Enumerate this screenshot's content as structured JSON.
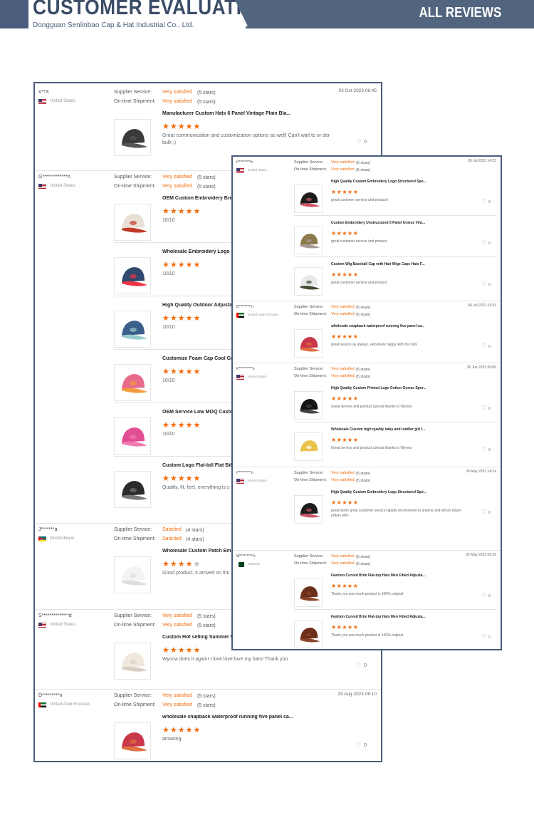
{
  "header": {
    "title": "CUSTOMER EVALUATION",
    "subtitle": "Dongguan Senlinbao Cap & Hat Industrial Co., Ltd.",
    "right": "ALL REVIEWS"
  },
  "labels": {
    "supplier": "Supplier Service:",
    "shipment": "On-time Shipment:"
  },
  "left_reviews": [
    {
      "name": "V**X",
      "country": "United States",
      "flag": "us",
      "supplier": "Very satisfied",
      "supplier_stars": "(5 stars)",
      "shipment": "Very satisfied",
      "shipment_stars": "(5 stars)",
      "date": "03 Oct 2023 06:45",
      "items": [
        {
          "title": "Manufacturer Custom Hats 6 Panel Vintage Plain Bla...",
          "rating": "★★★★★",
          "text": "Great communication and customization options as well! Can't wait to or der bulk :)",
          "likes": "0",
          "img": "dark"
        }
      ]
    },
    {
      "name": "G*************n",
      "country": "United States",
      "flag": "us",
      "supplier": "Very satisfied",
      "supplier_stars": "(5 stars)",
      "shipment": "Very satisfied",
      "shipment_stars": "(5 stars)",
      "date": "",
      "items": [
        {
          "title": "OEM Custom Embroidery Brea",
          "rating": "★★★★★",
          "text": "10/10",
          "likes": "",
          "img": "trucker"
        },
        {
          "title": "Wholesale Embroidery Logo C",
          "rating": "★★★★★",
          "text": "10/10",
          "likes": "",
          "img": "navy"
        },
        {
          "title": "High Quality Outdoor Adjustal",
          "rating": "★★★★★",
          "text": "10/10",
          "likes": "",
          "img": "multi"
        },
        {
          "title": "Customize Foam Cap Cool Gr",
          "rating": "★★★★★",
          "text": "10/10",
          "likes": "",
          "img": "pinkmix"
        },
        {
          "title": "OEM Service Low MOQ Custo",
          "rating": "★★★★★",
          "text": "10/10",
          "likes": "",
          "img": "pink"
        },
        {
          "title": "Custom Logo Flat-bill Flat Bill",
          "rating": "★★★★★",
          "text": "Quality, fit, feel, everything is s n 7 panel hat. Very impressed!",
          "likes": "",
          "img": "mesh"
        }
      ]
    },
    {
      "name": "J*******a",
      "country": "Mozambique",
      "flag": "mz",
      "supplier": "Satisfied",
      "supplier_stars": "(4 stars)",
      "shipment": "",
      "shipment_stars": "",
      "date": "",
      "items": [
        {
          "title": "Wholesale Custom Patch Emb",
          "rating": "★★★★",
          "rating_off": "★",
          "text": "Good product, it arrived on tim 1 minor request missed",
          "likes": "",
          "img": "white"
        }
      ]
    },
    {
      "name": "S**************d",
      "country": "United States",
      "flag": "us",
      "supplier": "Very satisfied",
      "supplier_stars": "(5 stars)",
      "shipment": "Very satisfied",
      "shipment_stars": "(5 stars)",
      "date": "",
      "items": [
        {
          "title": "Custom Hot selling Summer W",
          "rating": "★★★★★",
          "text": "Wyona does it again! I love love love my hats! Thank you",
          "likes": "0",
          "img": "bucket"
        }
      ]
    },
    {
      "name": "D*********n",
      "country": "United Arab Emirates",
      "flag": "uae",
      "supplier": "Very satisfied",
      "supplier_stars": "(5 stars)",
      "shipment": "Very satisfied",
      "shipment_stars": "(5 stars)",
      "date": "29 Aug 2023 06:10",
      "items": [
        {
          "title": "wholesale snapback waterproof running five panel ca...",
          "rating": "★★★★★",
          "text": "amazing",
          "likes": "0",
          "img": "red"
        }
      ]
    }
  ],
  "right_reviews": [
    {
      "name": "t**********n",
      "country": "United States",
      "flag": "us",
      "supplier": "Very satisfied",
      "supplier_stars": "(5 stars)",
      "shipment": "Very satisfied",
      "shipment_stars": "(5 stars)",
      "date": "26 Jul 2023 14:23",
      "items": [
        {
          "title": "High Quality Custom Embroidery Logo Structured Spo...",
          "rating": "★★★★★",
          "text": "great customer service and product!",
          "likes": "0",
          "img": "black"
        },
        {
          "title": "Custom Embroidery Unstructured 5 Panel Unisex Vint...",
          "rating": "★★★★★",
          "text": "great customer service and product",
          "likes": "0",
          "img": "olive"
        },
        {
          "title": "Custom Wig Baseball Cap with Hair Wigs Caps Hats F...",
          "rating": "★★★★★",
          "text": "great customer service and product",
          "likes": "0",
          "img": "wig"
        }
      ]
    },
    {
      "name": "D*********n",
      "country": "United Arab Emirates",
      "flag": "uae",
      "supplier": "Very satisfied",
      "supplier_stars": "(5 stars)",
      "shipment": "Very satisfied",
      "shipment_stars": "(5 stars)",
      "date": "04 Jul 2023 19:33",
      "items": [
        {
          "title": "wholesale snapback waterproof running five panel ca...",
          "rating": "★★★★★",
          "text": "great service as always, extremely happy with the hats",
          "likes": "0",
          "img": "red"
        }
      ]
    },
    {
      "name": "K**********o",
      "country": "United States",
      "flag": "us",
      "supplier": "Very satisfied",
      "supplier_stars": "(5 stars)",
      "shipment": "Very satisfied",
      "shipment_stars": "(5 stars)",
      "date": "26 Jun 2023 09:06",
      "items": [
        {
          "title": "High Quality Custom Printed Logo Cotton Gorras Spor...",
          "rating": "★★★★★",
          "text": "Great service and product special thanks to Wyona",
          "likes": "0",
          "img": "black2"
        },
        {
          "title": "Wholesale Custom high quality baby and toddler girl f...",
          "rating": "★★★★★",
          "text": "Great service and product special thanks to Wyona",
          "likes": "0",
          "img": "yellow"
        }
      ]
    },
    {
      "name": "t**********n",
      "country": "United States",
      "flag": "us",
      "supplier": "Very satisfied",
      "supplier_stars": "(5 stars)",
      "shipment": "Very satisfied",
      "shipment_stars": "(5 stars)",
      "date": "24 May 2023 14:24",
      "items": [
        {
          "title": "High Quality Custom Embroidery Logo Structured Spo...",
          "rating": "★★★★★",
          "text": "great work! great customer service! gladly recommend to anyone and will do future orders with",
          "likes": "0",
          "img": "black"
        }
      ]
    },
    {
      "name": "W**********c",
      "country": "Pakistan",
      "flag": "pk",
      "supplier": "Very satisfied",
      "supplier_stars": "(5 stars)",
      "shipment": "Very satisfied",
      "shipment_stars": "(5 stars)",
      "date": "02 May 2023 09:26",
      "items": [
        {
          "title": "Fashion Curved Brim Flat-top Hats Men Fitted Adjusta...",
          "rating": "★★★★★",
          "text": "Thank you soo much product is 100% original",
          "likes": "0",
          "img": "leather"
        },
        {
          "title": "Fashion Curved Brim Flat-top Hats Men Fitted Adjusta...",
          "rating": "★★★★★",
          "text": "Thank you soo much product is 100% original",
          "likes": "0",
          "img": "leather"
        }
      ]
    }
  ]
}
